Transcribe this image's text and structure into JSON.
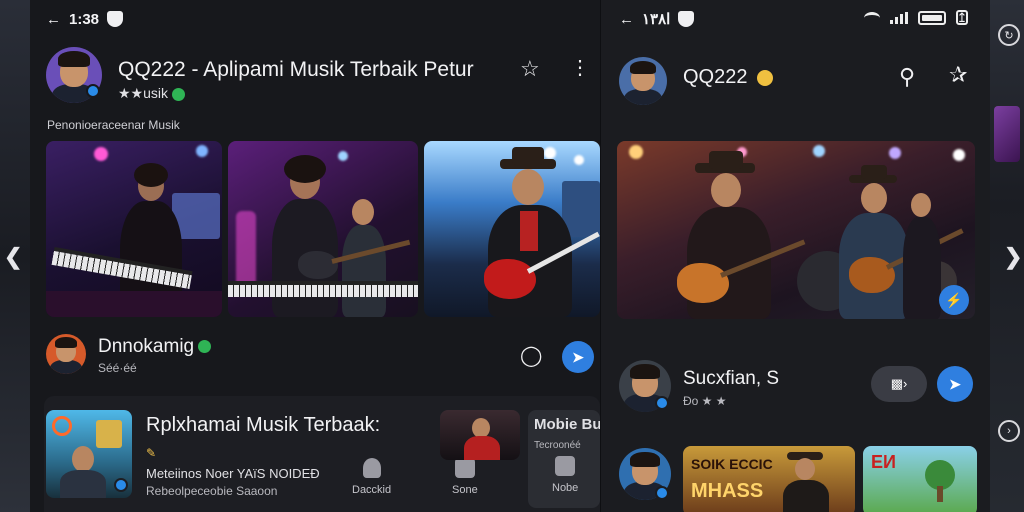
{
  "left": {
    "status_time": "1:38",
    "app_title": "QQ222 - Aplipami Musik Terbaik Petur",
    "app_subtitle": "★★usik",
    "section_label": "Penonioeraceenar Musik",
    "artist_name": "Dnnokamig",
    "artist_meta": "Séé·éé",
    "feature_title": "Rplxhamai Musik Terbaak:",
    "feature_line1": "Meteiinos Noer YAïS NOIDEÐ",
    "feature_line2": "Rebeolpeceobie Saaoon",
    "mini_card_title": "Mobie Buoc",
    "mini_card_sub": "Tecroonéé",
    "nav_items": [
      {
        "label": "Dacckid"
      },
      {
        "label": "Sone"
      },
      {
        "label": "Nobe"
      }
    ]
  },
  "right": {
    "status_time": "ا۱۳۸",
    "app_title": "QQ222",
    "user_name": "Sucxfian, S",
    "user_meta": "Ðo ★ ★",
    "promo_text_1": "SOIK ECCIC",
    "promo_text_2": "MHASS",
    "promo_text_3": "EИ"
  },
  "colors": {
    "accent_blue": "#2f7fe0",
    "verified_green": "#2fb455",
    "panel_bg": "#17181c"
  }
}
